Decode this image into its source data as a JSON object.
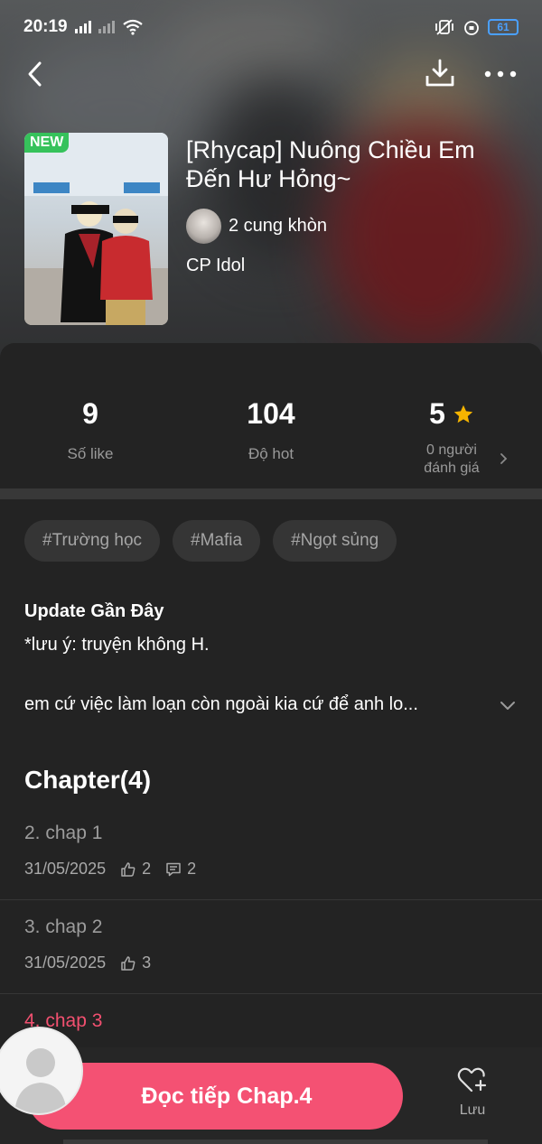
{
  "status_bar": {
    "time": "20:19",
    "battery": "61"
  },
  "book": {
    "new_badge": "NEW",
    "title": "[Rhycap] Nuông Chiều Em Đến Hư Hỏng~",
    "author": "2 cung khòn",
    "category": "CP Idol"
  },
  "stats": {
    "likes_value": "9",
    "likes_label": "Số like",
    "hot_value": "104",
    "hot_label": "Độ hot",
    "rating_value": "5",
    "rating_label_line1": "0 người",
    "rating_label_line2": "đánh giá"
  },
  "tags": [
    "#Trường học",
    "#Mafia",
    "#Ngọt sủng"
  ],
  "description": {
    "update_title": "Update Gần Đây",
    "note": "*lưu ý: truyện không H.",
    "synopsis": "em cứ việc làm loạn còn ngoài kia cứ để anh lo..."
  },
  "chapters": {
    "heading": "Chapter(4)",
    "items": [
      {
        "title": "2. chap 1",
        "date": "31/05/2025",
        "likes": "2",
        "comments": "2"
      },
      {
        "title": "3. chap 2",
        "date": "31/05/2025",
        "likes": "3"
      },
      {
        "title": "4. chap 3"
      }
    ]
  },
  "actions": {
    "read_label": "Đọc tiếp Chap.4",
    "save_label": "Lưu"
  },
  "colors": {
    "accent": "#f45173",
    "active_chapter": "#f25070",
    "new_badge": "#36c25b",
    "star": "#f5b400"
  },
  "icons": [
    "back-arrow-icon",
    "download-icon",
    "more-icon",
    "star-icon",
    "chevron-right-icon",
    "chevron-down-icon",
    "thumbs-up-icon",
    "comment-icon",
    "heart-plus-icon"
  ]
}
